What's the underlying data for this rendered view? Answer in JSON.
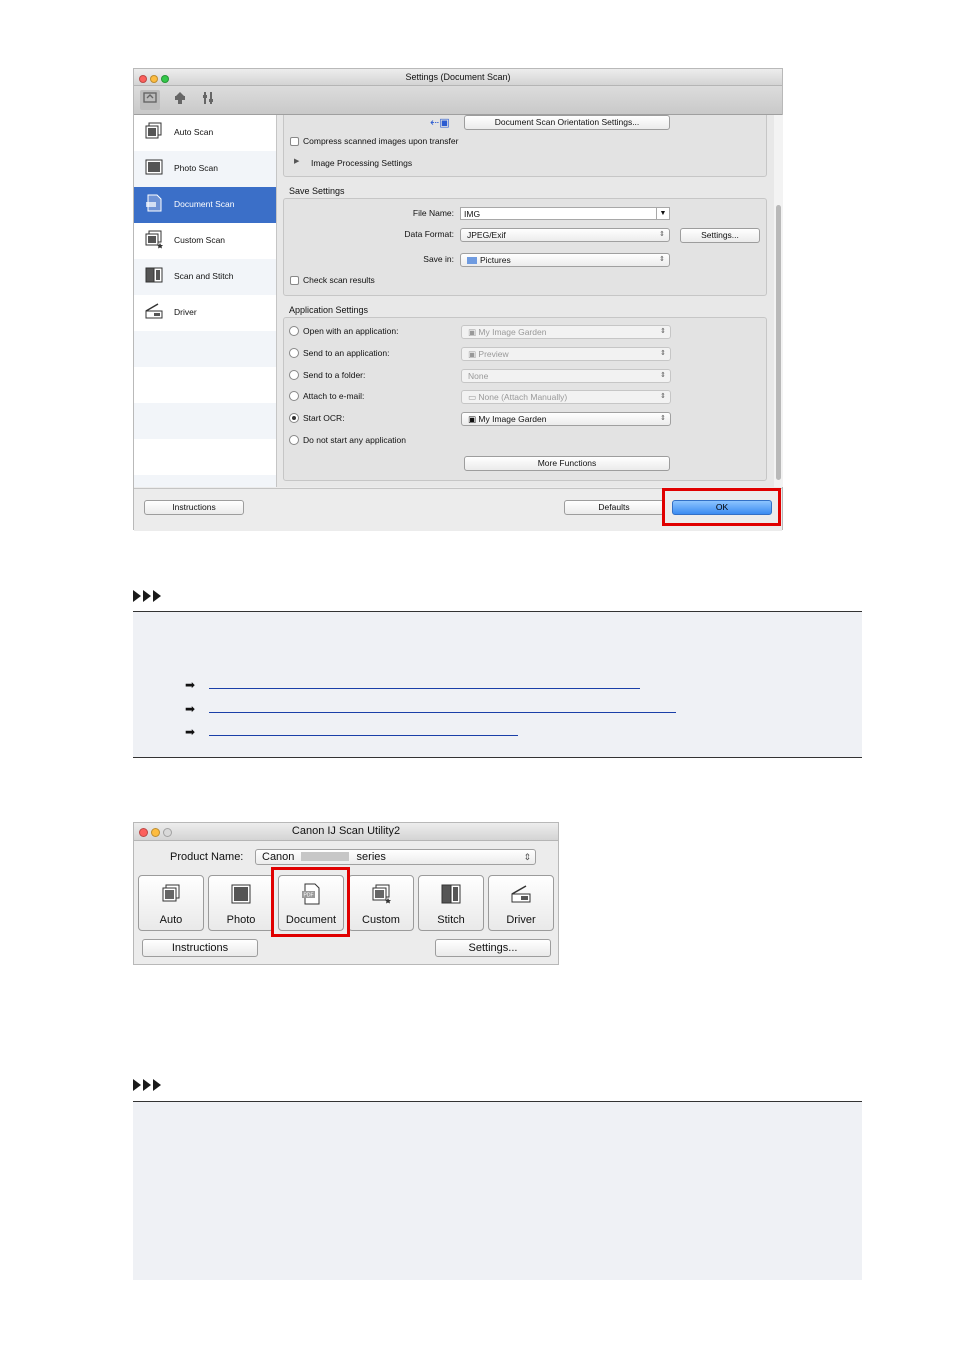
{
  "settings_window": {
    "title": "Settings (Document Scan)",
    "colors": {
      "selected": "#3b6fc8",
      "highlight_box": "#e00000",
      "ok_button": "#3b8cf2"
    },
    "toolbar_icons": [
      "scan-from-computer-icon",
      "scan-from-panel-icon",
      "general-settings-icon"
    ],
    "sidebar": [
      {
        "label": "Auto Scan",
        "icon": "auto-scan-icon",
        "selected": false
      },
      {
        "label": "Photo Scan",
        "icon": "photo-scan-icon",
        "selected": false
      },
      {
        "label": "Document Scan",
        "icon": "document-scan-icon",
        "selected": true
      },
      {
        "label": "Custom Scan",
        "icon": "custom-scan-icon",
        "selected": false
      },
      {
        "label": "Scan and Stitch",
        "icon": "stitch-icon",
        "selected": false
      },
      {
        "label": "Driver",
        "icon": "driver-icon",
        "selected": false
      }
    ],
    "scan_options": {
      "orientation_button": "Document Scan Orientation Settings...",
      "compress_label": "Compress scanned images upon transfer",
      "image_processing_label": "Image Processing Settings"
    },
    "save_settings": {
      "title": "Save Settings",
      "file_name_label": "File Name:",
      "file_name_value": "IMG",
      "data_format_label": "Data Format:",
      "data_format_value": "JPEG/Exif",
      "settings_button": "Settings...",
      "save_in_label": "Save in:",
      "save_in_value": "Pictures",
      "check_results_label": "Check scan results"
    },
    "application_settings": {
      "title": "Application Settings",
      "options": [
        {
          "label": "Open with an application:",
          "value": "My Image Garden",
          "selected": false,
          "enabled": false
        },
        {
          "label": "Send to an application:",
          "value": "Preview",
          "selected": false,
          "enabled": false
        },
        {
          "label": "Send to a folder:",
          "value": "None",
          "selected": false,
          "enabled": false
        },
        {
          "label": "Attach to e-mail:",
          "value": "None (Attach Manually)",
          "selected": false,
          "enabled": false
        },
        {
          "label": "Start OCR:",
          "value": "My Image Garden",
          "selected": true,
          "enabled": true
        },
        {
          "label": "Do not start any application",
          "value": "",
          "selected": false,
          "enabled": true
        }
      ],
      "more_functions_button": "More Functions"
    },
    "footer": {
      "instructions_button": "Instructions",
      "defaults_button": "Defaults",
      "ok_button": "OK"
    }
  },
  "utility_window": {
    "title": "Canon IJ Scan Utility2",
    "product_label": "Product Name:",
    "product_value_prefix": "Canon",
    "product_value_suffix": "series",
    "tiles": [
      {
        "label": "Auto",
        "icon": "auto-scan-icon"
      },
      {
        "label": "Photo",
        "icon": "photo-scan-icon"
      },
      {
        "label": "Document",
        "icon": "document-pdf-icon"
      },
      {
        "label": "Custom",
        "icon": "custom-scan-icon"
      },
      {
        "label": "Stitch",
        "icon": "stitch-icon"
      },
      {
        "label": "Driver",
        "icon": "driver-icon"
      }
    ],
    "instructions_button": "Instructions",
    "settings_button": "Settings..."
  }
}
